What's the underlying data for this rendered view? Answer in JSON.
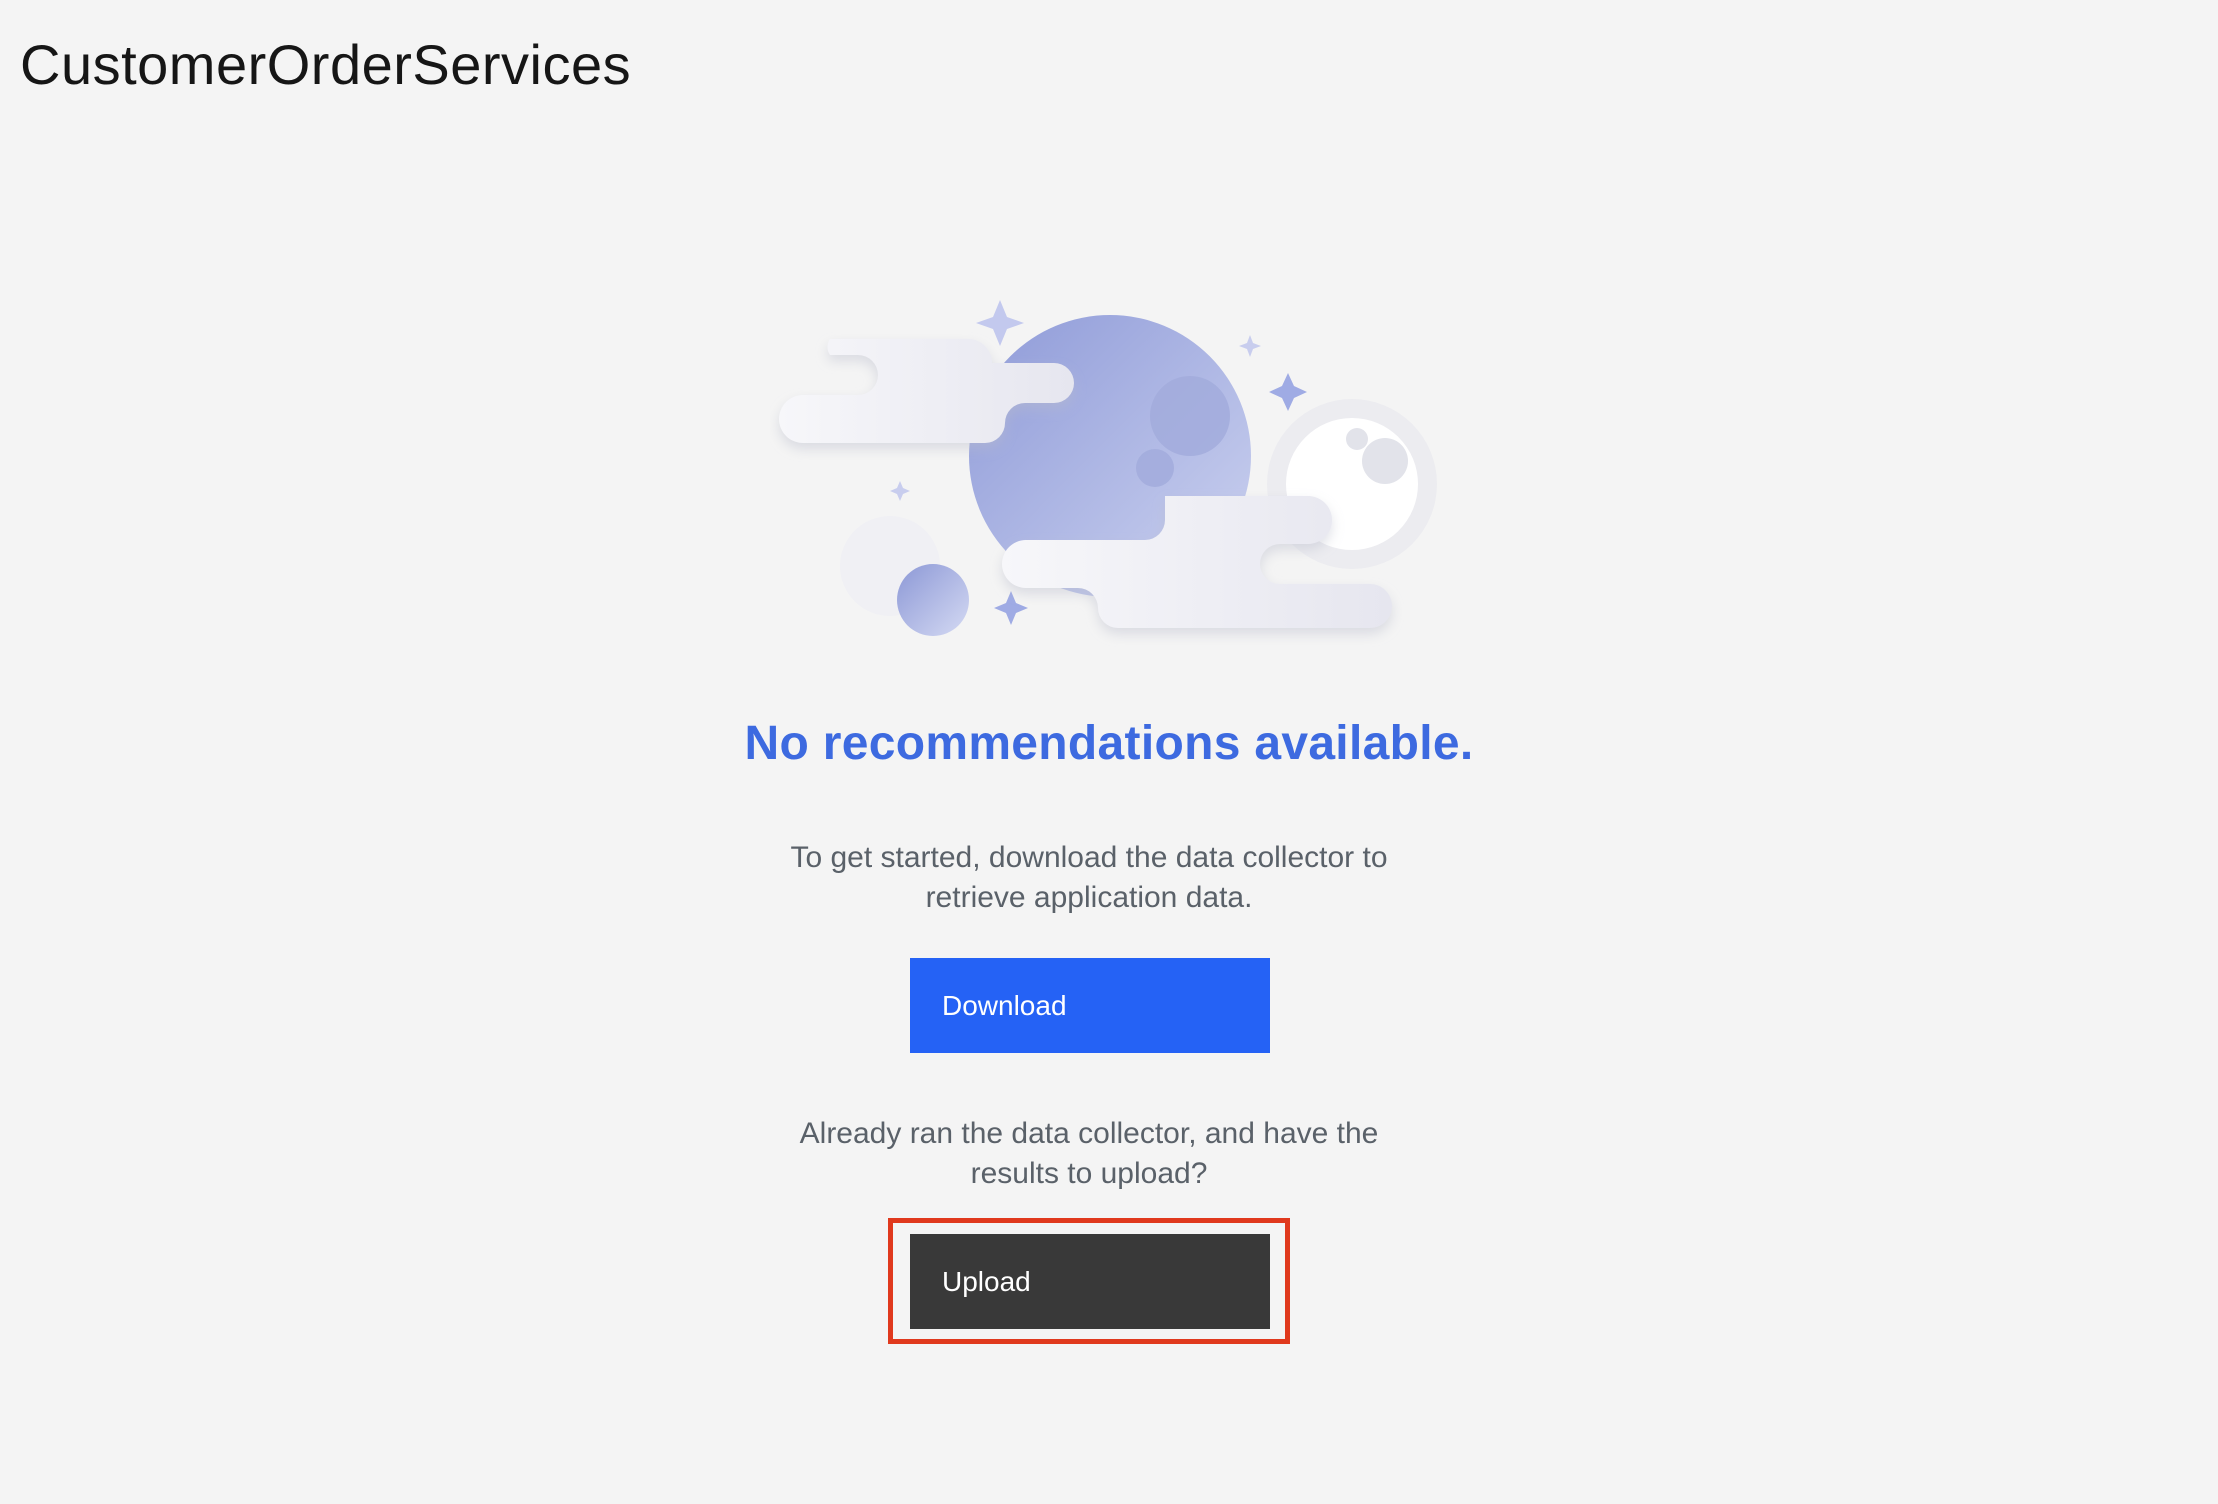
{
  "header": {
    "title": "CustomerOrderServices"
  },
  "empty_state": {
    "illustration_name": "moon-clouds-illustration",
    "heading": "No recommendations available.",
    "download_description": "To get started, download the data collector to retrieve application data.",
    "download_label": "Download",
    "upload_description": "Already ran the data collector, and have the results to upload?",
    "upload_label": "Upload"
  },
  "colors": {
    "background": "#f4f4f4",
    "heading": "#3d6ae0",
    "primary_button": "#2562f5",
    "secondary_button": "#393939",
    "highlight": "#e0391d"
  }
}
